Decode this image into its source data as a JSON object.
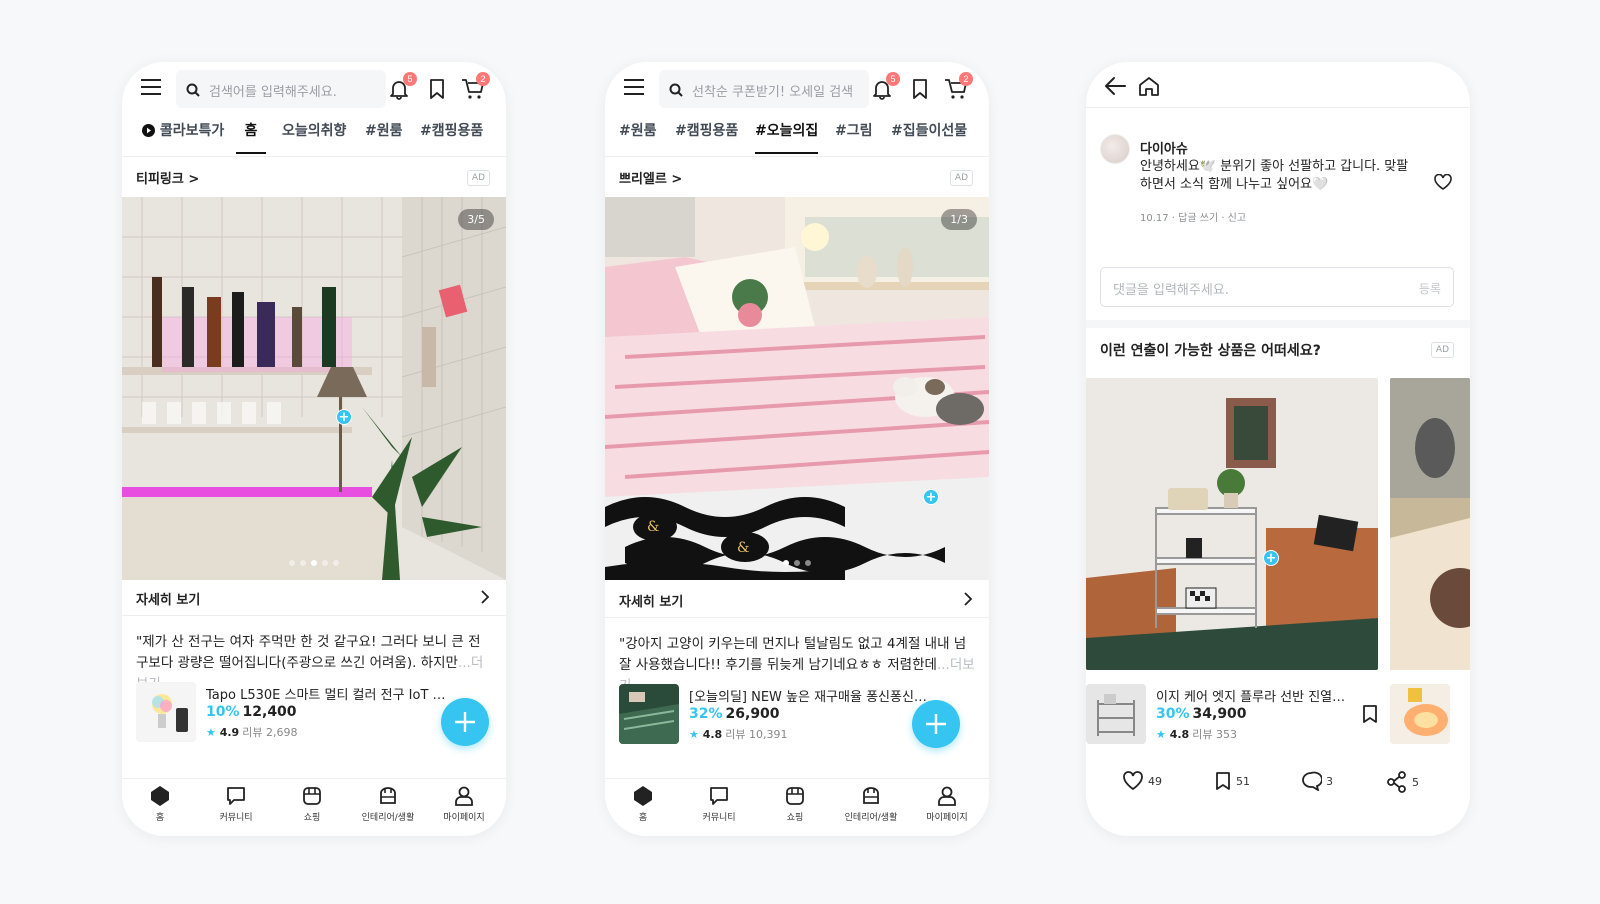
{
  "screens": [
    {
      "search_placeholder": "검색어를 입력해주세요.",
      "notif_count": "5",
      "cart_count": "2",
      "tabs": [
        "콜라보특가",
        "홈",
        "오늘의취향",
        "#원룸",
        "#캠핑용품"
      ],
      "active_tab": "홈",
      "brand": "티피링크 >",
      "ad_label": "AD",
      "image_counter": "3/5",
      "more_label": "자세히 보기",
      "quote": "\"제가 산 전구는 여자 주먹만 한 것 같구요! 그러다 보니 큰 전구보다 광량은 떨어집니다(주광으로 쓰긴 어려움). 하지만",
      "quote_more": "...더보기",
      "product": {
        "name": "Tapo L530E 스마트 멀티 컬러 전구 IoT LE...",
        "discount": "10%",
        "price": "12,400",
        "rating": "4.9",
        "reviews": "리뷰 2,698"
      }
    },
    {
      "search_placeholder": "선착순 쿠폰받기! 오세일 검색",
      "notif_count": "5",
      "cart_count": "2",
      "tabs": [
        "#원룸",
        "#캠핑용품",
        "#오늘의집",
        "#그림",
        "#집들이선물"
      ],
      "active_tab": "#오늘의집",
      "brand": "쁘리엘르 >",
      "ad_label": "AD",
      "image_counter": "1/3",
      "more_label": "자세히 보기",
      "quote": "\"강아지 고양이 키우는데 먼지나 털날림도 없고 4계절 내내 넘 잘 사용했습니다!! 후기를 뒤늦게 남기네요ㅎㅎ 저렴한데",
      "quote_more": "...더보기",
      "product": {
        "name": "[오늘의딜] NEW 높은 재구매율 퐁신퐁신 유...",
        "discount": "32%",
        "price": "26,900",
        "rating": "4.8",
        "reviews": "리뷰 10,391"
      }
    },
    {
      "comment": {
        "user": "다이아슈",
        "text": "안녕하세요🕊️ 분위기 좋아 선팔하고 갑니다. 맞팔하면서 소식 함께 나누고 싶어요🤍",
        "meta": "10.17 · 답글 쓰기 · 신고"
      },
      "comment_placeholder": "댓글을 입력해주세요.",
      "submit_label": "등록",
      "section_title": "이런 연출이 가능한 상품은 어떠세요?",
      "ad_label": "AD",
      "product": {
        "name": "이지 케어 엣지 플루라 선반 진열장...",
        "discount": "30%",
        "price": "34,900",
        "rating": "4.8",
        "reviews": "리뷰 353"
      },
      "actions": {
        "likes": "49",
        "bookmarks": "51",
        "comments": "3",
        "shares": "5"
      }
    }
  ],
  "bottom_nav": [
    "홈",
    "커뮤니티",
    "쇼핑",
    "인테리어/생활",
    "마이페이지"
  ],
  "colors": {
    "accent": "#35c5f0",
    "badge": "#ff7777",
    "background": "#f7f8fa"
  },
  "icons": [
    "menu-icon",
    "search-icon",
    "bell-icon",
    "bookmark-icon",
    "cart-icon",
    "chevron-right-icon",
    "plus-icon",
    "home-icon",
    "chat-icon",
    "shop-icon",
    "interior-icon",
    "person-icon",
    "back-arrow-icon",
    "heart-icon",
    "share-icon"
  ]
}
